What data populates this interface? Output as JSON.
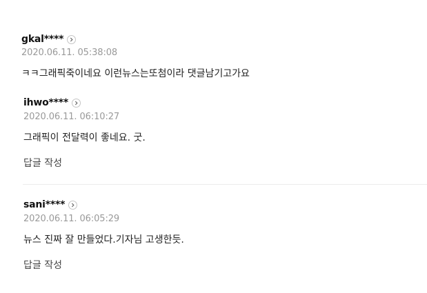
{
  "comments": [
    {
      "user": "gkal****",
      "date": "2020.06.11. 05:38:08",
      "text": "ㅋㅋ그래픽죽이네요 이런뉴스는또첨이라 댓글남기고가요"
    },
    {
      "user": "ihwo****",
      "date": "2020.06.11. 06:10:27",
      "text": "그래픽이 전달력이 좋네요. 굿.",
      "reply_label": "답글 작성"
    },
    {
      "user": "sani****",
      "date": "2020.06.11. 06:05:29",
      "text": "뉴스 진짜 잘 만들었다.기자님 고생한듯.",
      "reply_label": "답글 작성"
    }
  ],
  "icons": {
    "profile_link": "chevron-right-icon"
  }
}
